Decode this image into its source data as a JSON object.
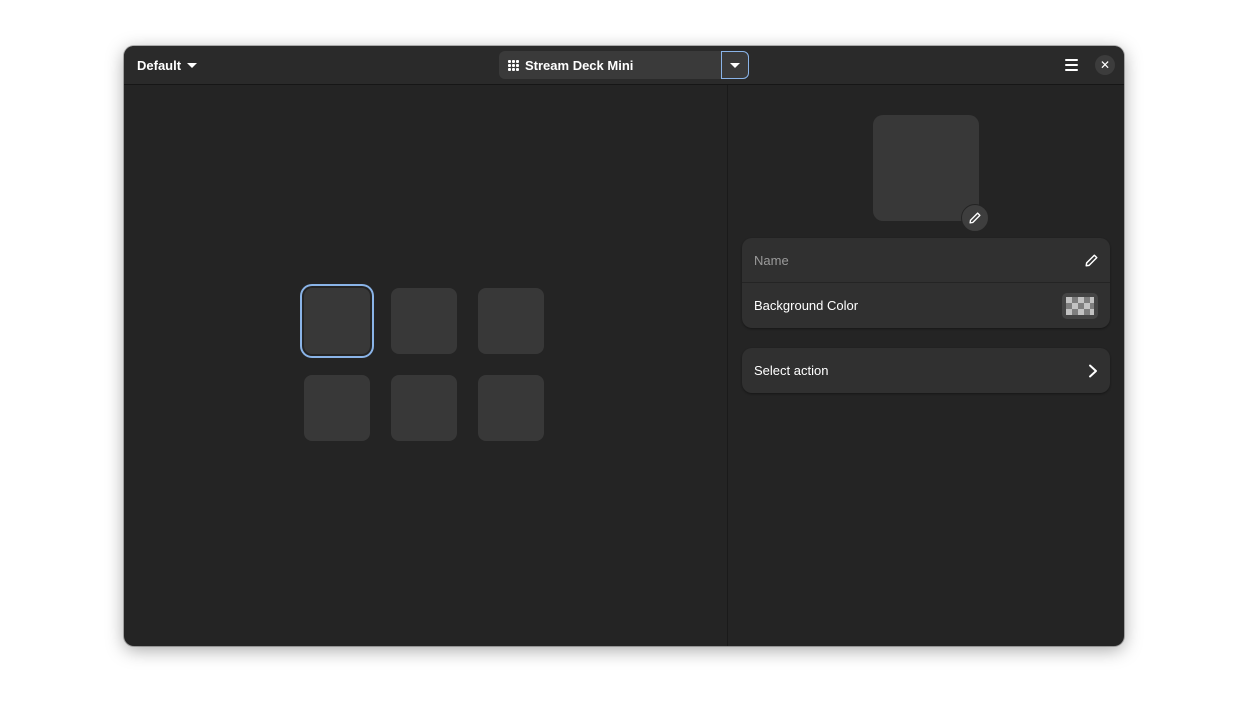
{
  "header": {
    "profile_label": "Default",
    "device_label": "Stream Deck Mini",
    "device_icon": "grid-icon",
    "device_dropdown_icon": "chevron-down-icon",
    "menu_icon": "hamburger-menu-icon",
    "close_icon": "close-icon",
    "close_glyph": "✕"
  },
  "deck": {
    "rows": 2,
    "columns": 3,
    "selected_key": 0
  },
  "key_settings": {
    "preview_edit_icon": "pencil-icon",
    "name_placeholder": "Name",
    "name_value": "",
    "name_edit_icon": "pencil-icon",
    "background_color_label": "Background Color",
    "background_color_value": "transparent",
    "select_action_label": "Select action",
    "select_action_icon": "chevron-right-icon"
  },
  "colors": {
    "window_bg": "#242424",
    "headerbar_bg": "#2a2a2a",
    "card_bg": "#303030",
    "key_bg": "#383838",
    "accent": "#8ab4e8",
    "text": "#ffffff",
    "dim_text": "#9a9a9a"
  }
}
